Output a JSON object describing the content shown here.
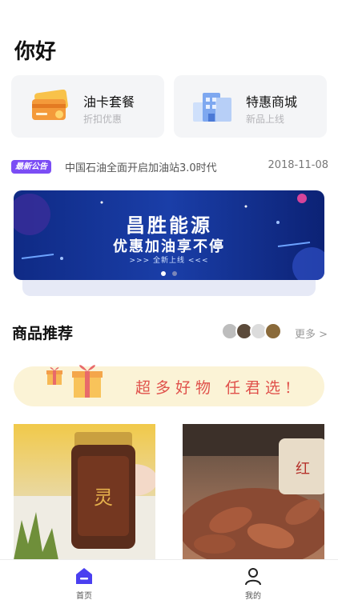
{
  "header": {
    "greeting": "你好"
  },
  "cards": [
    {
      "title": "油卡套餐",
      "subtitle": "折扣优惠",
      "icon": "fuel-card-icon"
    },
    {
      "title": "特惠商城",
      "subtitle": "新品上线",
      "icon": "shop-building-icon"
    }
  ],
  "notice": {
    "tag": "最新公告",
    "text": "中国石油全面开启加油站3.0时代",
    "date": "2018-11-08"
  },
  "banner": {
    "title": "昌胜能源",
    "subtitle": "优惠加油享不停",
    "tag": ">>>   全新上线   <<<",
    "slides": 2,
    "active_slide": 1
  },
  "products": {
    "section_title": "商品推荐",
    "more_label": "更多 >",
    "promo_text": "超多好物  任君选!"
  },
  "tabbar": {
    "home_label": "首页",
    "mine_label": "我的"
  },
  "colors": {
    "accent": "#7b4df5",
    "home_active": "#4a3ff0",
    "promo_bg": "#fbf3d6",
    "promo_text": "#e0514b"
  }
}
